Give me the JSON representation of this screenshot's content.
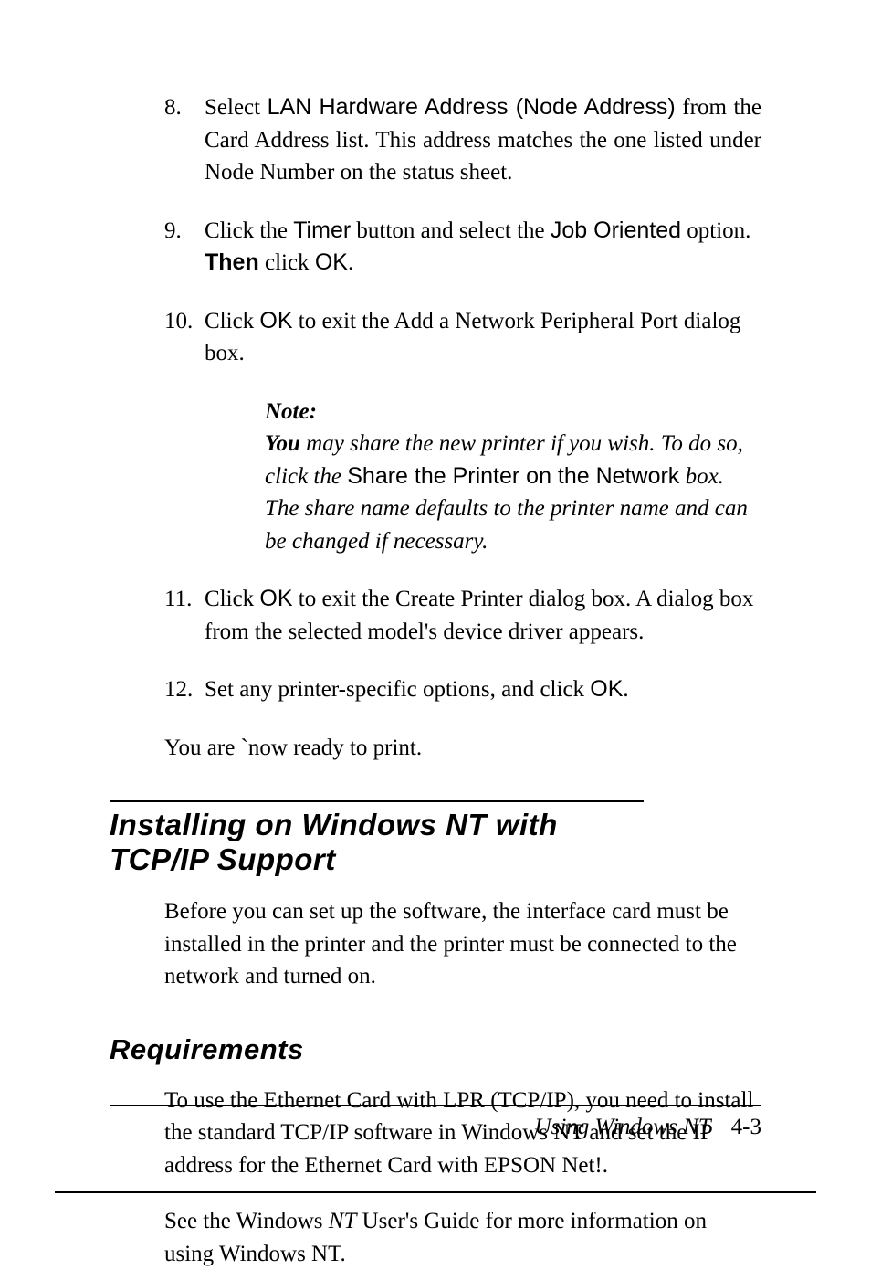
{
  "items": {
    "i8": {
      "num": "8.",
      "p1": "Select ",
      "p2": "LAN Hardware Address (Node Address)",
      "p3": " from the Card Address list. This address matches the one listed under Node Number on the status sheet."
    },
    "i9": {
      "num": "9.",
      "p1": "Click the ",
      "p2": "Timer",
      "p3": " button and select the ",
      "p4": "Job Oriented",
      "p5": " option. ",
      "p6": "Then",
      "p7": " click ",
      "p8": "OK",
      "p9": "."
    },
    "i10": {
      "num": "10.",
      "p1": "Click ",
      "p2": "OK",
      "p3": " to exit the Add a Network Peripheral Port dialog box."
    },
    "note": {
      "head": "Note:",
      "p1": "You",
      "p2": " may share the new printer if you wish. To do so, click the ",
      "p3": "Share the Printer on the Network",
      "p4": " box. The share name defaults to the printer name and can be changed if necessary."
    },
    "i11": {
      "num": "11.",
      "p1": "Click ",
      "p2": "OK",
      "p3": " to exit the Create Printer dialog box. A dialog box from the selected model's device driver appears."
    },
    "i12": {
      "num": "12.",
      "p1": "Set any printer-specific options, and click ",
      "p2": "OK",
      "p3": "."
    },
    "ready": "You are `now ready to print."
  },
  "h1": "Installing on Windows NT with TCP/IP Support",
  "intro": "Before you can set up the software, the interface card must be installed in the printer and the printer must be connected to the network and turned on.",
  "h2": "Requirements",
  "req1": "To use the Ethernet Card with LPR (TCP/IP), you need to install the standard TCP/IP software in Windows NT and set the IP address for the Ethernet Card with EPSON Net!.",
  "req2a": "See the Windows ",
  "req2b": "NT",
  "req2c": " User's Guide for more information on using Windows NT.",
  "footer": {
    "title": "Using Windows NT",
    "page": "4-3"
  }
}
